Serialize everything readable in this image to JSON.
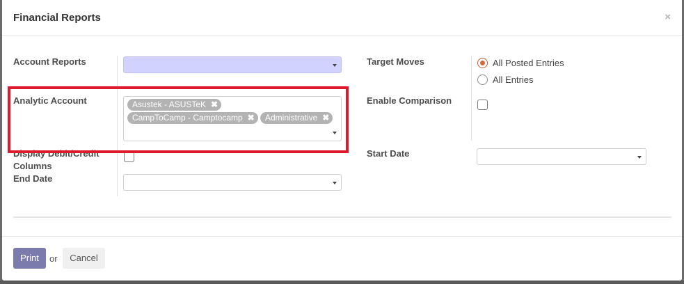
{
  "dialog": {
    "title": "Financial Reports",
    "close_symbol": "×"
  },
  "form": {
    "account_reports_label": "Account Reports",
    "analytic_account_label": "Analytic Account",
    "analytic_tags": [
      {
        "label": "Asustek - ASUSTeK"
      },
      {
        "label": "CampToCamp - Camptocamp"
      },
      {
        "label": "Administrative"
      }
    ],
    "display_debit_credit_label_line1": "Display Debit/Credit",
    "display_debit_credit_label_line2": "Columns",
    "end_date_label": "End Date",
    "target_moves_label": "Target Moves",
    "target_moves_options": [
      {
        "label": "All Posted Entries",
        "checked": true
      },
      {
        "label": "All Entries",
        "checked": false
      }
    ],
    "enable_comparison_label": "Enable Comparison",
    "start_date_label": "Start Date"
  },
  "footer": {
    "print_label": "Print",
    "or_label": "or",
    "cancel_label": "Cancel"
  },
  "colors": {
    "primary_button": "#7c7bad",
    "highlight_select": "#d2d2ff",
    "annotation_red": "#dd1b2c",
    "radio_checked": "#d2693d"
  }
}
